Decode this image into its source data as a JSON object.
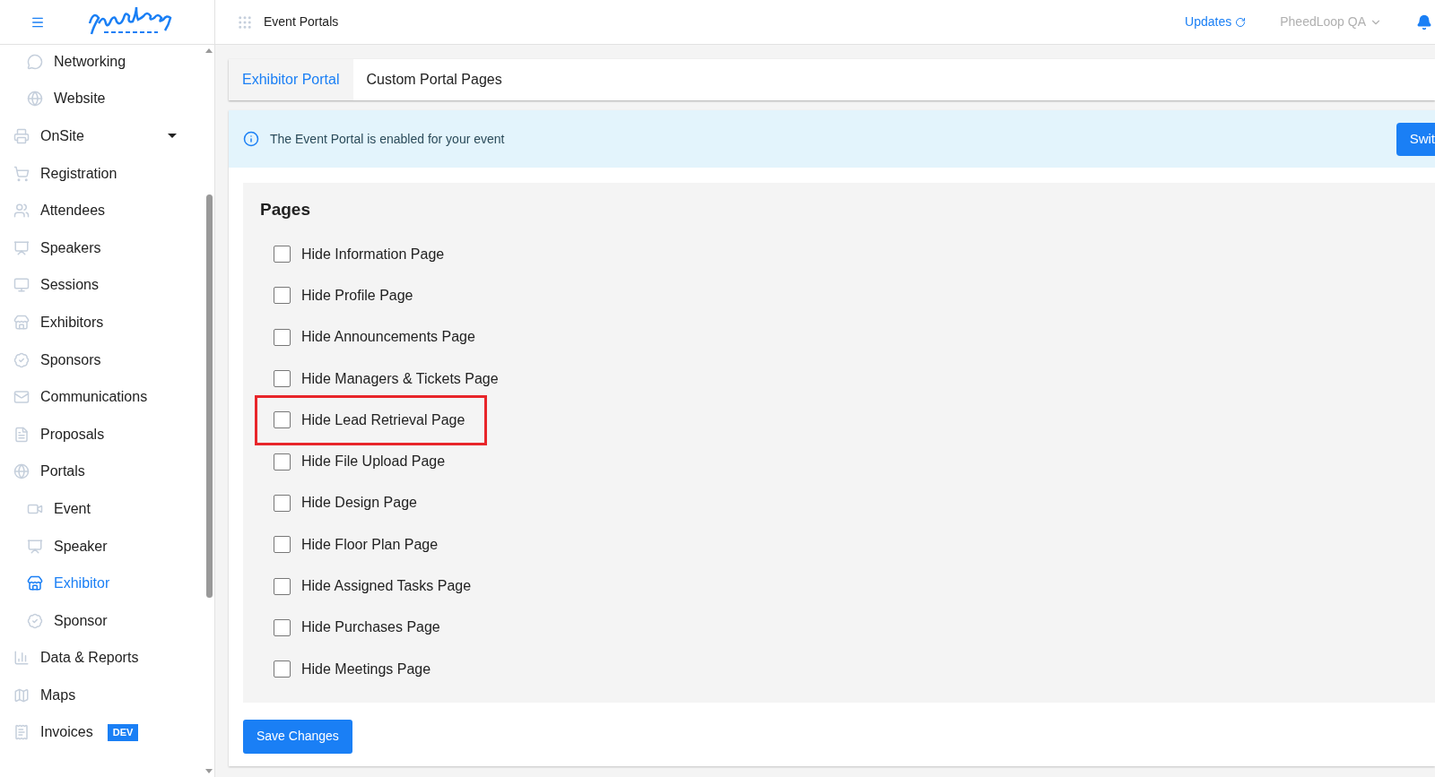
{
  "topbar": {
    "title": "Event Portals",
    "updates": "Updates",
    "account": "PheedLoop QA"
  },
  "sidebar": {
    "continued_children": [
      {
        "label": "Networking",
        "selected": false
      },
      {
        "label": "Website",
        "selected": false
      }
    ],
    "items": [
      {
        "label": "OnSite",
        "selected": false,
        "expanded": false
      },
      {
        "label": "Registration",
        "selected": false
      },
      {
        "label": "Attendees",
        "selected": false
      },
      {
        "label": "Speakers",
        "selected": false
      },
      {
        "label": "Sessions",
        "selected": false
      },
      {
        "label": "Exhibitors",
        "selected": false
      },
      {
        "label": "Sponsors",
        "selected": false
      },
      {
        "label": "Communications",
        "selected": false
      },
      {
        "label": "Proposals",
        "selected": false
      },
      {
        "label": "Portals",
        "selected": false,
        "children": [
          {
            "label": "Event",
            "selected": false
          },
          {
            "label": "Speaker",
            "selected": false
          },
          {
            "label": "Exhibitor",
            "selected": true
          },
          {
            "label": "Sponsor",
            "selected": false
          }
        ]
      },
      {
        "label": "Data & Reports",
        "selected": false
      },
      {
        "label": "Maps",
        "selected": false
      },
      {
        "label": "Invoices",
        "selected": false,
        "badge": "DEV"
      }
    ]
  },
  "tabs": [
    {
      "label": "Exhibitor Portal",
      "selected": true
    },
    {
      "label": "Custom Portal Pages",
      "selected": false
    }
  ],
  "banner": {
    "text": "The Event Portal is enabled for your event",
    "button": "Swit"
  },
  "pages": {
    "title": "Pages",
    "options": [
      {
        "label": "Hide Information Page",
        "checked": false,
        "highlighted": false
      },
      {
        "label": "Hide Profile Page",
        "checked": false,
        "highlighted": false
      },
      {
        "label": "Hide Announcements Page",
        "checked": false,
        "highlighted": false
      },
      {
        "label": "Hide Managers & Tickets Page",
        "checked": false,
        "highlighted": false
      },
      {
        "label": "Hide Lead Retrieval Page",
        "checked": false,
        "highlighted": true
      },
      {
        "label": "Hide File Upload Page",
        "checked": false,
        "highlighted": false
      },
      {
        "label": "Hide Design Page",
        "checked": false,
        "highlighted": false
      },
      {
        "label": "Hide Floor Plan Page",
        "checked": false,
        "highlighted": false
      },
      {
        "label": "Hide Assigned Tasks Page",
        "checked": false,
        "highlighted": false
      },
      {
        "label": "Hide Purchases Page",
        "checked": false,
        "highlighted": false
      },
      {
        "label": "Hide Meetings Page",
        "checked": false,
        "highlighted": false
      }
    ]
  },
  "save_button": "Save Changes"
}
